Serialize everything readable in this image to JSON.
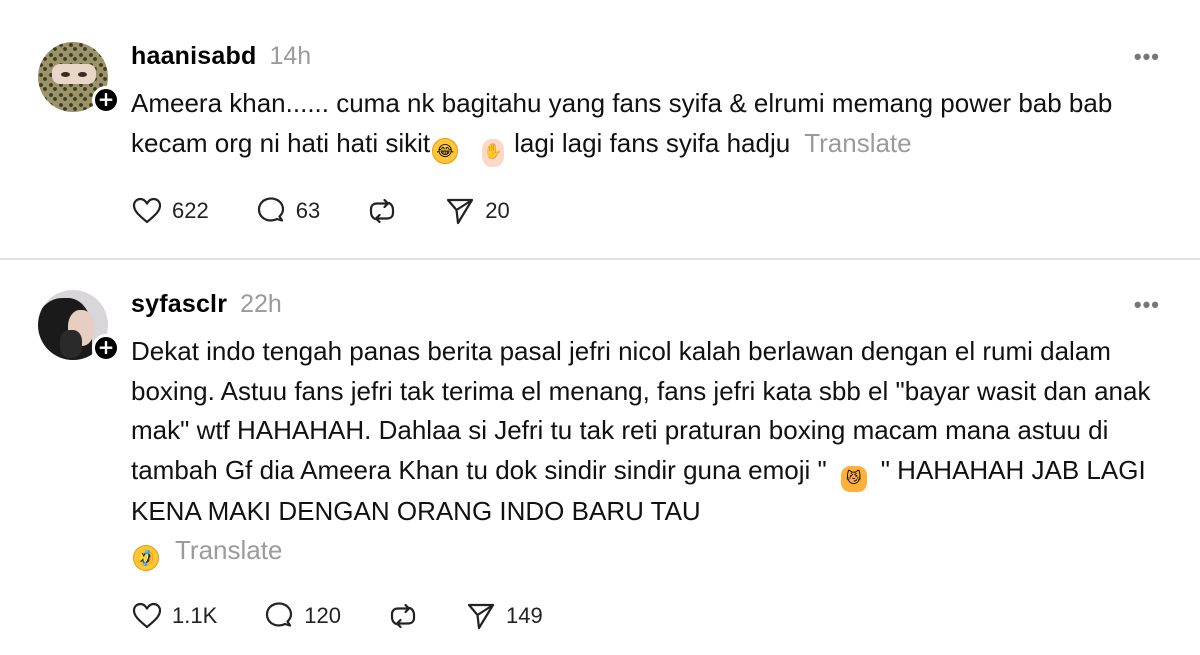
{
  "posts": [
    {
      "username": "haanisabd",
      "time": "14h",
      "more_label": "•••",
      "follow_label": "+",
      "text_before_emoji": "Ameera khan...... cuma nk bagitahu yang fans syifa & elrumi memang power bab bab kecam org ni hati hati sikit",
      "emoji_1": "😂",
      "emoji_2": "✋",
      "text_after_emoji": "lagi lagi fans syifa hadju",
      "translate_label": "Translate",
      "likes": "622",
      "replies": "63",
      "reposts": "",
      "shares": "20"
    },
    {
      "username": "syfasclr",
      "time": "22h",
      "more_label": "•••",
      "follow_label": "+",
      "text_before_emoji": "Dekat indo tengah panas berita pasal jefri nicol kalah berlawan dengan el rumi dalam boxing. Astuu fans jefri tak terima el menang, fans jefri kata sbb el \"bayar wasit dan anak mak\" wtf HAHAHAH. Dahlaa si Jefri tu tak reti praturan boxing macam mana astuu di tambah Gf dia Ameera Khan tu dok sindir sindir guna emoji \"",
      "emoji_1": "😼",
      "text_after_emoji": "\" HAHAHAH JAB LAGI KENA MAKI DENGAN ORANG INDO BARU TAU",
      "emoji_2": "🤣",
      "translate_label": "Translate",
      "likes": "1.1K",
      "replies": "120",
      "reposts": "",
      "shares": "149"
    }
  ],
  "icons": {
    "like": "heart-icon",
    "reply": "comment-icon",
    "repost": "repost-icon",
    "share": "send-icon"
  }
}
